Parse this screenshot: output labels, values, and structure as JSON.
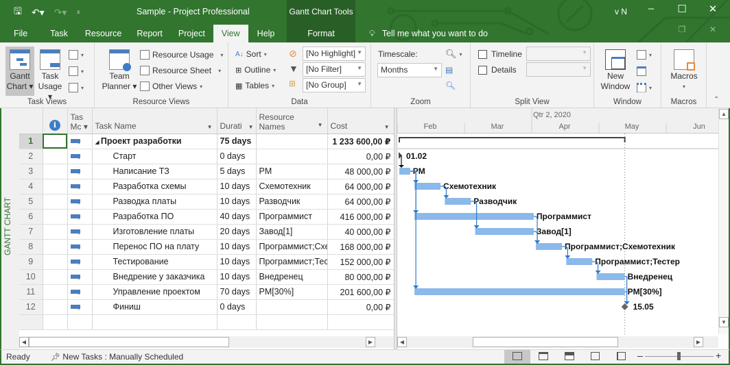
{
  "window": {
    "title": "Sample  -  Project Professional",
    "context_tab_group": "Gantt Chart Tools",
    "user": "v N",
    "tell_me": "Tell me what you want to do"
  },
  "tabs": [
    {
      "label": "File"
    },
    {
      "label": "Task"
    },
    {
      "label": "Resource"
    },
    {
      "label": "Report"
    },
    {
      "label": "Project"
    },
    {
      "label": "View",
      "active": true
    },
    {
      "label": "Help"
    }
  ],
  "context_tab": "Format",
  "ribbon": {
    "task_views": {
      "label": "Task Views",
      "gantt_chart": [
        "Gantt",
        "Chart ▾"
      ],
      "task_usage": [
        "Task",
        "Usage ▾"
      ]
    },
    "resource_views": {
      "label": "Resource Views",
      "team_planner": [
        "Team",
        "Planner ▾"
      ],
      "resource_usage": "Resource Usage",
      "resource_sheet": "Resource Sheet",
      "other_views": "Other Views"
    },
    "data": {
      "label": "Data",
      "sort": "Sort",
      "outline": "Outline",
      "tables": "Tables",
      "highlight": "[No Highlight]",
      "filter": "[No Filter]",
      "group": "[No Group]"
    },
    "zoom": {
      "label": "Zoom",
      "timescale_label": "Timescale:",
      "timescale_value": "Months"
    },
    "split_view": {
      "label": "Split View",
      "timeline": "Timeline",
      "timeline_checked": false,
      "details": "Details",
      "details_checked": false
    },
    "window": {
      "label": "Window",
      "new_window": [
        "New",
        "Window"
      ]
    },
    "macros": {
      "label": "Macros",
      "macros_btn": "Macros"
    }
  },
  "view_bar_label": "GANTT CHART",
  "columns": {
    "task_mode": [
      "Tas",
      "Mc ▾"
    ],
    "task_name": "Task Name",
    "duration": "Durati",
    "resource_names": [
      "Resource",
      "Names"
    ],
    "cost": "Cost"
  },
  "tasks": [
    {
      "id": "1",
      "name": "Проект разработки",
      "duration": "75 days",
      "resources": "",
      "cost": "1 233 600,00 ₽",
      "summary": true
    },
    {
      "id": "2",
      "name": "Старт",
      "duration": "0 days",
      "resources": "",
      "cost": "0,00 ₽"
    },
    {
      "id": "3",
      "name": "Написание ТЗ",
      "duration": "5 days",
      "resources": "PM",
      "cost": "48 000,00 ₽"
    },
    {
      "id": "4",
      "name": "Разработка схемы",
      "duration": "10 days",
      "resources": "Схемотехник",
      "cost": "64 000,00 ₽"
    },
    {
      "id": "5",
      "name": "Разводка платы",
      "duration": "10 days",
      "resources": "Разводчик",
      "cost": "64 000,00 ₽"
    },
    {
      "id": "6",
      "name": "Разработка ПО",
      "duration": "40 days",
      "resources": "Программист",
      "cost": "416 000,00 ₽"
    },
    {
      "id": "7",
      "name": "Изготовление платы",
      "duration": "20 days",
      "resources": "Завод[1]",
      "cost": "40 000,00 ₽"
    },
    {
      "id": "8",
      "name": "Перенос ПО на плату",
      "duration": "10 days",
      "resources": "Программист;Схемотехник",
      "cost": "168 000,00 ₽"
    },
    {
      "id": "9",
      "name": "Тестирование",
      "duration": "10 days",
      "resources": "Программист;Тестер",
      "cost": "152 000,00 ₽"
    },
    {
      "id": "10",
      "name": "Внедрение у заказчика",
      "duration": "10 days",
      "resources": "Внедренец",
      "cost": "80 000,00 ₽"
    },
    {
      "id": "11",
      "name": "Управление проектом",
      "duration": "70 days",
      "resources": "PM[30%]",
      "cost": "201 600,00 ₽"
    },
    {
      "id": "12",
      "name": "Финиш",
      "duration": "0 days",
      "resources": "",
      "cost": "0,00 ₽"
    }
  ],
  "gantt": {
    "quarter_label": "Qtr 2, 2020",
    "months": [
      "Feb",
      "Mar",
      "Apr",
      "May",
      "Jun"
    ],
    "start_milestone_label": "01.02",
    "finish_milestone_label": "15.05",
    "bar_color": "#8ab9ea",
    "link_color": "#2f78cc"
  },
  "status": {
    "ready": "Ready",
    "new_tasks": "New Tasks : Manually Scheduled"
  }
}
